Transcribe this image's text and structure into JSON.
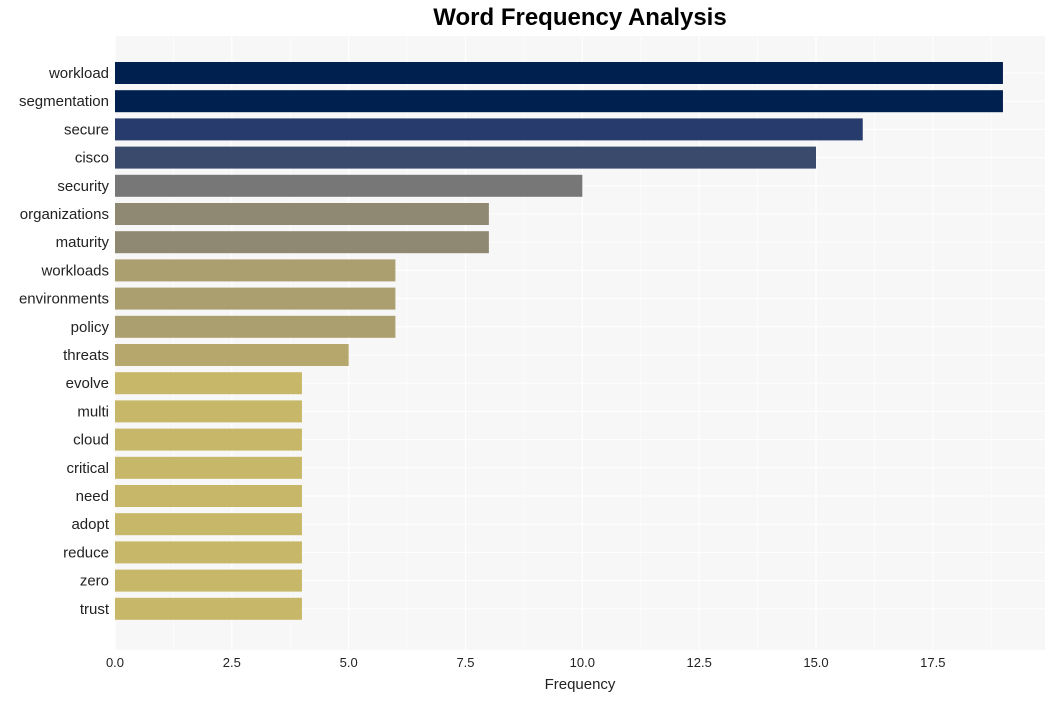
{
  "chart_data": {
    "type": "bar",
    "orientation": "horizontal",
    "title": "Word Frequency Analysis",
    "xlabel": "Frequency",
    "ylabel": "",
    "xlim": [
      0,
      19.9
    ],
    "xticks": [
      0.0,
      2.5,
      5.0,
      7.5,
      10.0,
      12.5,
      15.0,
      17.5
    ],
    "xtick_labels": [
      "0.0",
      "2.5",
      "5.0",
      "7.5",
      "10.0",
      "12.5",
      "15.0",
      "17.5"
    ],
    "grid": true,
    "categories": [
      "workload",
      "segmentation",
      "secure",
      "cisco",
      "security",
      "organizations",
      "maturity",
      "workloads",
      "environments",
      "policy",
      "threats",
      "evolve",
      "multi",
      "cloud",
      "critical",
      "need",
      "adopt",
      "reduce",
      "zero",
      "trust"
    ],
    "values": [
      19,
      19,
      16,
      15,
      10,
      8,
      8,
      6,
      6,
      6,
      5,
      4,
      4,
      4,
      4,
      4,
      4,
      4,
      4,
      4
    ],
    "colors": [
      "#00204f",
      "#00204f",
      "#273c6d",
      "#3a4a6c",
      "#777777",
      "#8f8872",
      "#8f8872",
      "#ab9f70",
      "#ab9f70",
      "#ab9f70",
      "#b6a76d",
      "#c7b768",
      "#c7b768",
      "#c7b768",
      "#c7b768",
      "#c7b768",
      "#c7b768",
      "#c7b768",
      "#c7b768",
      "#c7b768"
    ],
    "background": "#f7f7f7"
  }
}
